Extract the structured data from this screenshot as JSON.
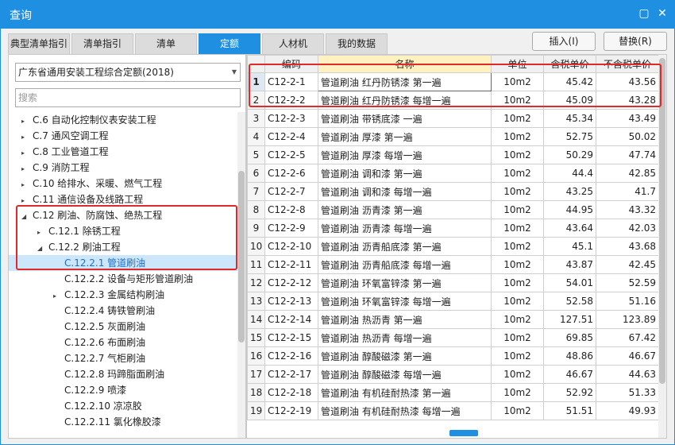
{
  "window": {
    "title": "查询",
    "minimize_icon": "minimize-icon",
    "close_icon": "close-icon"
  },
  "tabs": [
    {
      "label": "典型清单指引",
      "active": false
    },
    {
      "label": "清单指引",
      "active": false
    },
    {
      "label": "清单",
      "active": false
    },
    {
      "label": "定额",
      "active": true
    },
    {
      "label": "人材机",
      "active": false
    },
    {
      "label": "我的数据",
      "active": false
    }
  ],
  "actions": {
    "insert_label": "插入(I)",
    "replace_label": "替换(R)"
  },
  "left": {
    "selected_norm": "广东省通用安装工程综合定额(2018)",
    "search_placeholder": "搜索",
    "tree": [
      {
        "label": "C.6 自动化控制仪表安装工程",
        "toggle": "▸",
        "level": 0
      },
      {
        "label": "C.7 通风空调工程",
        "toggle": "▸",
        "level": 0
      },
      {
        "label": "C.8 工业管道工程",
        "toggle": "▸",
        "level": 0
      },
      {
        "label": "C.9 消防工程",
        "toggle": "▸",
        "level": 0
      },
      {
        "label": "C.10 给排水、采暖、燃气工程",
        "toggle": "▸",
        "level": 0
      },
      {
        "label": "C.11 通信设备及线路工程",
        "toggle": "▸",
        "level": 0
      },
      {
        "label": "C.12 刷油、防腐蚀、绝热工程",
        "toggle": "◢",
        "level": 0
      },
      {
        "label": "C.12.1 除锈工程",
        "toggle": "▸",
        "level": 1
      },
      {
        "label": "C.12.2 刷油工程",
        "toggle": "◢",
        "level": 1
      },
      {
        "label": "C.12.2.1 管道刷油",
        "toggle": "",
        "level": 2,
        "selected": true
      },
      {
        "label": "C.12.2.2 设备与矩形管道刷油",
        "toggle": "",
        "level": 2
      },
      {
        "label": "C.12.2.3 金属结构刷油",
        "toggle": "▸",
        "level": 2
      },
      {
        "label": "C.12.2.4 铸铁管刷油",
        "toggle": "",
        "level": 2
      },
      {
        "label": "C.12.2.5 灰面刷油",
        "toggle": "",
        "level": 2
      },
      {
        "label": "C.12.2.6 布面刷油",
        "toggle": "",
        "level": 2
      },
      {
        "label": "C.12.2.7 气柜刷油",
        "toggle": "",
        "level": 2
      },
      {
        "label": "C.12.2.8 玛蹄脂面刷油",
        "toggle": "",
        "level": 2
      },
      {
        "label": "C.12.2.9 喷漆",
        "toggle": "",
        "level": 2
      },
      {
        "label": "C.12.2.10 凉凉胶",
        "toggle": "",
        "level": 2
      },
      {
        "label": "C.12.2.11 氯化橡胶漆",
        "toggle": "",
        "level": 2
      }
    ]
  },
  "table": {
    "headers": [
      "",
      "编码",
      "名称",
      "单位",
      "含税单价",
      "不含税单价"
    ],
    "rows": [
      [
        "1",
        "C12-2-1",
        "管道刷油 红丹防锈漆 第一遍",
        "10m2",
        "45.42",
        "43.56"
      ],
      [
        "2",
        "C12-2-2",
        "管道刷油 红丹防锈漆 每增一遍",
        "10m2",
        "45.09",
        "43.28"
      ],
      [
        "3",
        "C12-2-3",
        "管道刷油 带锈底漆 一遍",
        "10m2",
        "45.34",
        "43.49"
      ],
      [
        "4",
        "C12-2-4",
        "管道刷油 厚漆 第一遍",
        "10m2",
        "52.75",
        "50.02"
      ],
      [
        "5",
        "C12-2-5",
        "管道刷油 厚漆 每增一遍",
        "10m2",
        "50.29",
        "47.74"
      ],
      [
        "6",
        "C12-2-6",
        "管道刷油 调和漆 第一遍",
        "10m2",
        "44.4",
        "42.85"
      ],
      [
        "7",
        "C12-2-7",
        "管道刷油 调和漆 每增一遍",
        "10m2",
        "43.25",
        "41.7"
      ],
      [
        "8",
        "C12-2-8",
        "管道刷油 沥青漆 第一遍",
        "10m2",
        "44.95",
        "43.32"
      ],
      [
        "9",
        "C12-2-9",
        "管道刷油 沥青漆 每增一遍",
        "10m2",
        "43.64",
        "42.03"
      ],
      [
        "10",
        "C12-2-10",
        "管道刷油 沥青船底漆 第一遍",
        "10m2",
        "45.1",
        "43.68"
      ],
      [
        "11",
        "C12-2-11",
        "管道刷油 沥青船底漆 每增一遍",
        "10m2",
        "43.87",
        "42.45"
      ],
      [
        "12",
        "C12-2-12",
        "管道刷油 环氧富锌漆 第一遍",
        "10m2",
        "54.01",
        "52.59"
      ],
      [
        "13",
        "C12-2-13",
        "管道刷油 环氧富锌漆 每增一遍",
        "10m2",
        "52.58",
        "51.16"
      ],
      [
        "14",
        "C12-2-14",
        "管道刷油 热沥青 第一遍",
        "10m2",
        "127.51",
        "123.89"
      ],
      [
        "15",
        "C12-2-15",
        "管道刷油 热沥青 每增一遍",
        "10m2",
        "69.85",
        "67.42"
      ],
      [
        "16",
        "C12-2-16",
        "管道刷油 醇酸磁漆 第一遍",
        "10m2",
        "48.86",
        "46.67"
      ],
      [
        "17",
        "C12-2-17",
        "管道刷油 醇酸磁漆 每增一遍",
        "10m2",
        "46.67",
        "44.63"
      ],
      [
        "18",
        "C12-2-18",
        "管道刷油 有机硅耐热漆 第一遍",
        "10m2",
        "52.92",
        "51.33"
      ],
      [
        "19",
        "C12-2-19",
        "管道刷油 有机硅耐热漆 每增一遍",
        "10m2",
        "51.51",
        "49.93"
      ]
    ]
  },
  "colors": {
    "accent": "#1e8fe1",
    "highlight_box": "#e0292b",
    "name_header": "#fff2c0",
    "tree_selected": "#cce6fb"
  }
}
